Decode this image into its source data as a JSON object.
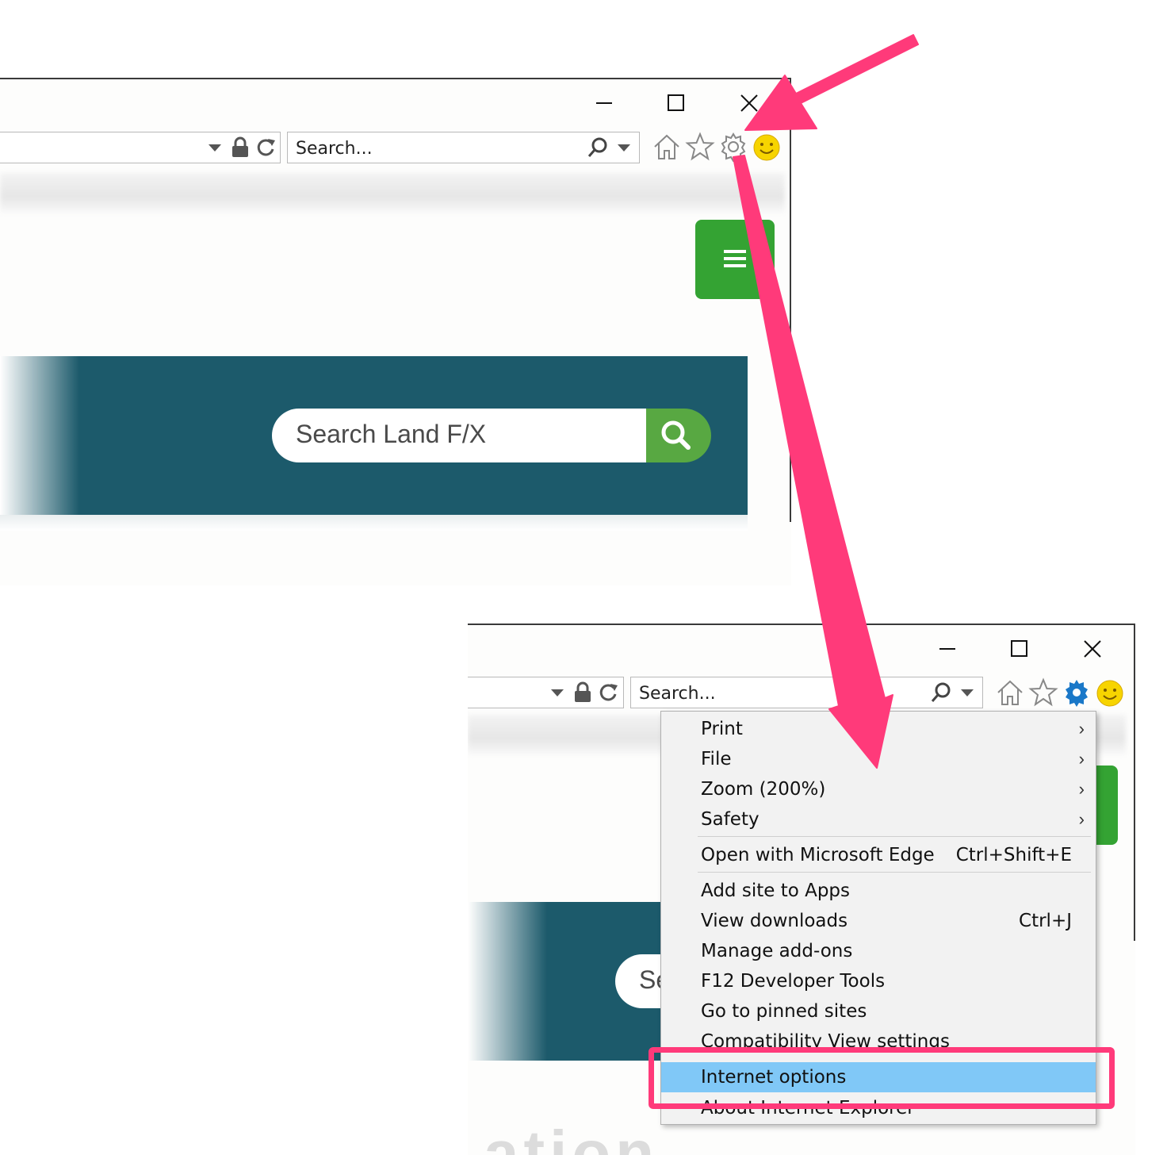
{
  "top_window": {
    "search_placeholder": "Search...",
    "site_search_placeholder": "Search Land F/X",
    "icons": [
      "minimize-icon",
      "maximize-icon",
      "close-icon",
      "dropdown-icon",
      "lock-icon",
      "refresh-icon",
      "search-icon",
      "home-icon",
      "favorites-star-icon",
      "gear-icon",
      "smiley-feedback-icon",
      "hamburger-menu-icon"
    ]
  },
  "bottom_window": {
    "search_placeholder": "Search...",
    "site_search_partial": "Se",
    "page_text_partial": "ation"
  },
  "tools_menu": {
    "items": [
      {
        "label": "Print",
        "submenu": true
      },
      {
        "label": "File",
        "submenu": true
      },
      {
        "label": "Zoom (200%)",
        "submenu": true
      },
      {
        "label": "Safety",
        "submenu": true
      },
      {
        "label": "Open with Microsoft Edge",
        "shortcut": "Ctrl+Shift+E"
      },
      {
        "label": "Add site to Apps"
      },
      {
        "label": "View downloads",
        "shortcut": "Ctrl+J"
      },
      {
        "label": "Manage add-ons"
      },
      {
        "label": "F12 Developer Tools"
      },
      {
        "label": "Go to pinned sites"
      },
      {
        "label": "Compatibility View settings"
      },
      {
        "label": "Internet options",
        "highlighted": true
      },
      {
        "label": "About Internet Explorer"
      }
    ]
  },
  "colors": {
    "annotation": "#ff3a7a",
    "banner": "#1c5a6b",
    "green_button": "#34a333",
    "search_button": "#58a842",
    "highlight": "#80c8f7"
  }
}
